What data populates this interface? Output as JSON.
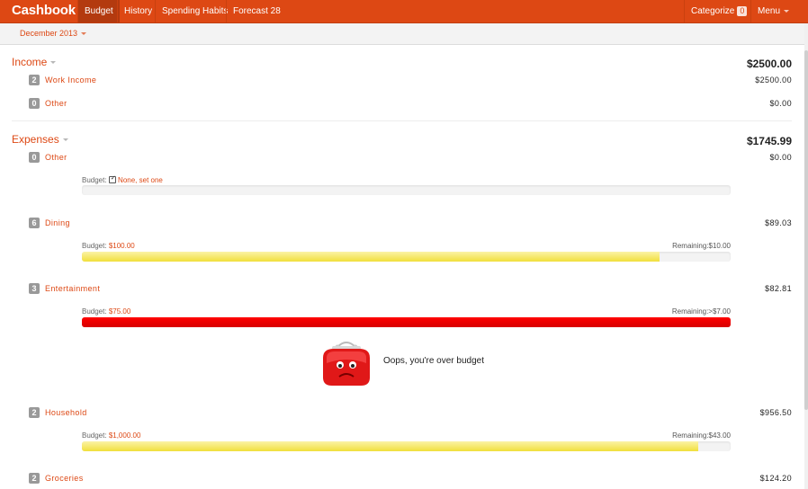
{
  "nav": {
    "brand": "Cashbook",
    "items": [
      {
        "label": "Budget"
      },
      {
        "label": "History"
      },
      {
        "label": "Spending Habits"
      },
      {
        "label": "Forecast 28"
      }
    ],
    "categorize_label": "Categorize",
    "categorize_count": "0",
    "menu_label": "Menu"
  },
  "subbar": {
    "month": "December 2013"
  },
  "income": {
    "title": "Income",
    "total": "$2500.00",
    "items": [
      {
        "count": "2",
        "name": "Work Income",
        "amount": "$2500.00"
      },
      {
        "count": "0",
        "name": "Other",
        "amount": "$0.00"
      }
    ]
  },
  "expenses": {
    "title": "Expenses",
    "total": "$1745.99",
    "items": [
      {
        "count": "0",
        "name": "Other",
        "amount": "$0.00",
        "budget_prefix": "Budget:",
        "budget_value": "None, set one",
        "remaining": "",
        "fill": 0,
        "color": "none"
      },
      {
        "count": "6",
        "name": "Dining",
        "amount": "$89.03",
        "budget_prefix": "Budget:",
        "budget_value": "$100.00",
        "remaining": "Remaining:$10.00",
        "fill": 0.89,
        "color": "yellow"
      },
      {
        "count": "3",
        "name": "Entertainment",
        "amount": "$82.81",
        "budget_prefix": "Budget:",
        "budget_value": "$75.00",
        "remaining": "Remaining:>$7.00",
        "fill": 1.0,
        "color": "red"
      },
      {
        "count": "2",
        "name": "Household",
        "amount": "$956.50",
        "budget_prefix": "Budget:",
        "budget_value": "$1,000.00",
        "remaining": "Remaining:$43.00",
        "fill": 0.95,
        "color": "yellow"
      },
      {
        "count": "2",
        "name": "Groceries",
        "amount": "$124.20"
      }
    ]
  },
  "over_budget": {
    "message": "Oops, you're over budget",
    "icon": "sad-purse-icon"
  },
  "colors": {
    "brand": "#dd4814",
    "over": "#ee0000",
    "under": "#f1df3c"
  }
}
